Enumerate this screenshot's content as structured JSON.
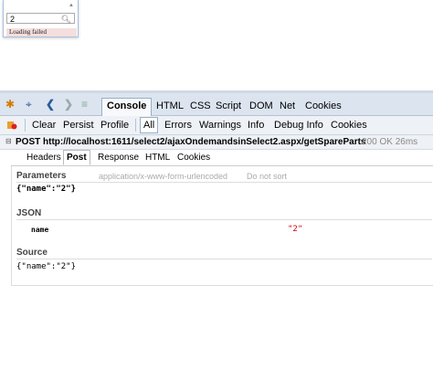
{
  "select2": {
    "search_value": "2",
    "message": "Loading failed"
  },
  "firebug": {
    "main_tabs": [
      "Console",
      "HTML",
      "CSS",
      "Script",
      "DOM",
      "Net",
      "Cookies"
    ],
    "selected_main_tab": "Console",
    "console_toolbar": [
      "Clear",
      "Persist",
      "Profile",
      "All",
      "Errors",
      "Warnings",
      "Info",
      "Debug Info",
      "Cookies"
    ],
    "request": {
      "method_url": "POST http://localhost:1611/select2/ajaxOndemandsinSelect2.aspx/getSpareParts",
      "status": "200 OK 26ms"
    },
    "request_tabs": [
      "Headers",
      "Post",
      "Response",
      "HTML",
      "Cookies"
    ],
    "post": {
      "parameters_heading": "Parameters",
      "content_type_hint": "application/x-www-form-urlencoded",
      "sort_hint": "Do not sort",
      "parameters_body": "{\"name\":\"2\"}",
      "json_heading": "JSON",
      "json_key": "name",
      "json_value": "\"2\"",
      "source_heading": "Source",
      "source_body": "{\"name\":\"2\"}"
    }
  }
}
